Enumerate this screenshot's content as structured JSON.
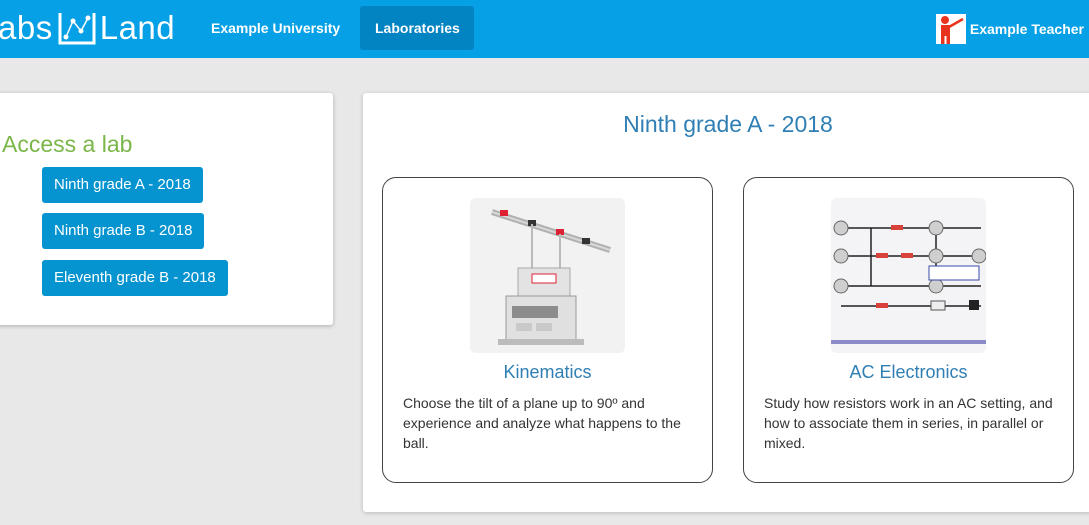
{
  "header": {
    "logo_left": "abs",
    "logo_right": "Land",
    "nav": [
      {
        "label": "Example University"
      },
      {
        "label": "Laboratories"
      }
    ],
    "user_name": "Example Teacher"
  },
  "sidebar": {
    "title": "Access a lab",
    "groups": [
      {
        "label": "Ninth grade A - 2018"
      },
      {
        "label": "Ninth grade B - 2018"
      },
      {
        "label": "Eleventh grade B - 2018"
      }
    ]
  },
  "main": {
    "title": "Ninth grade A - 2018",
    "labs": [
      {
        "name": "Kinematics",
        "description": "Choose the tilt of a plane up to 90º and experience and analyze what happens to the ball."
      },
      {
        "name": "AC Electronics",
        "description": "Study how resistors work in an AC setting, and how to associate them in series, in parallel or mixed."
      }
    ]
  },
  "colors": {
    "header_bg": "#05a0e6",
    "nav_active_bg": "#0283c2",
    "button_bg": "#0594d0",
    "access_title": "#7ab648",
    "link_blue": "#2f7fb5"
  }
}
